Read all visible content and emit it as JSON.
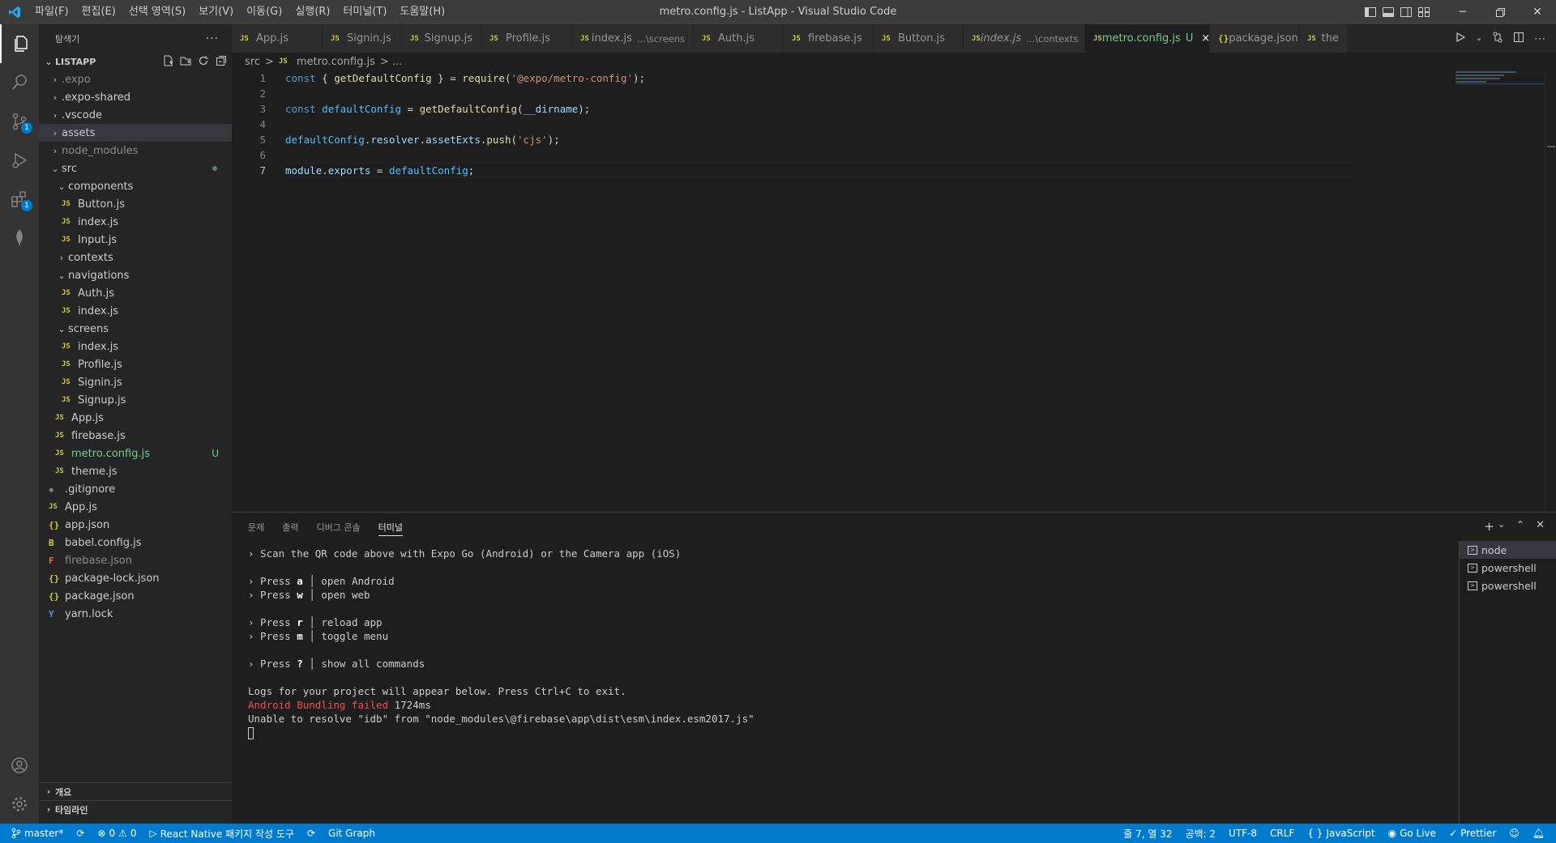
{
  "titlebar": {
    "title": "metro.config.js - ListApp - Visual Studio Code",
    "menu": [
      "파일(F)",
      "편집(E)",
      "선택 영역(S)",
      "보기(V)",
      "이동(G)",
      "실행(R)",
      "터미널(T)",
      "도움말(H)"
    ]
  },
  "activity": {
    "scm_badge": "1",
    "ext_badge": "1"
  },
  "sidebar": {
    "header": "탐색기",
    "more": "···",
    "section": "LISTAPP",
    "items": [
      {
        "label": ".expo",
        "chev": "›"
      },
      {
        "label": ".expo-shared",
        "chev": "›"
      },
      {
        "label": ".vscode",
        "chev": "›"
      },
      {
        "label": "assets",
        "chev": "›"
      },
      {
        "label": "node_modules",
        "chev": "›"
      },
      {
        "label": "src",
        "chev": "⌄"
      },
      {
        "label": "components",
        "chev": "⌄"
      },
      {
        "label": "Button.js",
        "icon": "JS"
      },
      {
        "label": "index.js",
        "icon": "JS"
      },
      {
        "label": "Input.js",
        "icon": "JS"
      },
      {
        "label": "contexts",
        "chev": "›"
      },
      {
        "label": "navigations",
        "chev": "⌄"
      },
      {
        "label": "Auth.js",
        "icon": "JS"
      },
      {
        "label": "index.js",
        "icon": "JS"
      },
      {
        "label": "screens",
        "chev": "⌄"
      },
      {
        "label": "index.js",
        "icon": "JS"
      },
      {
        "label": "Profile.js",
        "icon": "JS"
      },
      {
        "label": "Signin.js",
        "icon": "JS"
      },
      {
        "label": "Signup.js",
        "icon": "JS"
      },
      {
        "label": "App.js",
        "icon": "JS"
      },
      {
        "label": "firebase.js",
        "icon": "JS"
      },
      {
        "label": "metro.config.js",
        "icon": "JS",
        "status": "U"
      },
      {
        "label": "theme.js",
        "icon": "JS"
      },
      {
        "label": ".gitignore",
        "icon": "◆"
      },
      {
        "label": "App.js",
        "icon": "JS"
      },
      {
        "label": "app.json",
        "icon": "{}"
      },
      {
        "label": "babel.config.js",
        "icon": "B"
      },
      {
        "label": "firebase.json",
        "icon": "F"
      },
      {
        "label": "package-lock.json",
        "icon": "{}"
      },
      {
        "label": "package.json",
        "icon": "{}"
      },
      {
        "label": "yarn.lock",
        "icon": "Y"
      }
    ],
    "outline": "개요",
    "timeline": "타임라인"
  },
  "tabs": [
    {
      "label": "App.js",
      "icon": "JS"
    },
    {
      "label": "Signin.js",
      "icon": "JS"
    },
    {
      "label": "Signup.js",
      "icon": "JS"
    },
    {
      "label": "Profile.js",
      "icon": "JS"
    },
    {
      "label": "index.js",
      "icon": "JS",
      "desc": "...\\screens"
    },
    {
      "label": "Auth.js",
      "icon": "JS"
    },
    {
      "label": "firebase.js",
      "icon": "JS"
    },
    {
      "label": "Button.js",
      "icon": "JS"
    },
    {
      "label": "index.js",
      "icon": "JS",
      "desc": "...\\contexts"
    },
    {
      "label": "metro.config.js",
      "icon": "JS",
      "status": "U",
      "close": "×"
    },
    {
      "label": "package.json",
      "icon": "{}"
    },
    {
      "label": "the",
      "icon": "JS"
    }
  ],
  "breadcrumb": {
    "folder": "src",
    "sep": ">",
    "file": "metro.config.js",
    "tail": "> ..."
  },
  "editor": {
    "line_numbers": [
      "1",
      "2",
      "3",
      "4",
      "5",
      "6",
      "7"
    ],
    "lines": [
      "const { getDefaultConfig } = require('@expo/metro-config');",
      "",
      "const defaultConfig = getDefaultConfig(__dirname);",
      "",
      "defaultConfig.resolver.assetExts.push('cjs');",
      "",
      "module.exports = defaultConfig;"
    ]
  },
  "panel": {
    "tabs": [
      "문제",
      "출력",
      "디버그 콘솔",
      "터미널"
    ],
    "terminal_lines": [
      "› Scan the QR code above with Expo Go (Android) or the Camera app (iOS)",
      "",
      "› Press a │ open Android",
      "› Press w │ open web",
      "",
      "› Press r │ reload app",
      "› Press m │ toggle menu",
      "",
      "› Press ? │ show all commands",
      "",
      "Logs for your project will appear below. Press Ctrl+C to exit.",
      "Android Bundling failed 1724ms",
      "Unable to resolve \"idb\" from \"node_modules\\@firebase\\app\\dist\\esm\\index.esm2017.js\""
    ],
    "terminals": [
      "node",
      "powershell",
      "powershell"
    ]
  },
  "statusbar": {
    "branch": "master*",
    "errors": "0",
    "warnings": "0",
    "rn_tool": "React Native 패키지 작성 도구",
    "git_graph": "Git Graph",
    "position": "줄 7, 열 32",
    "spaces": "공백: 2",
    "encoding": "UTF-8",
    "eol": "CRLF",
    "language": "JavaScript",
    "golive": "Go Live",
    "prettier": "Prettier"
  },
  "colors": {
    "accent": "#007acc",
    "titlebar": "#3c3c3c",
    "error": "#f14c4c",
    "git_untracked": "#73c991"
  }
}
